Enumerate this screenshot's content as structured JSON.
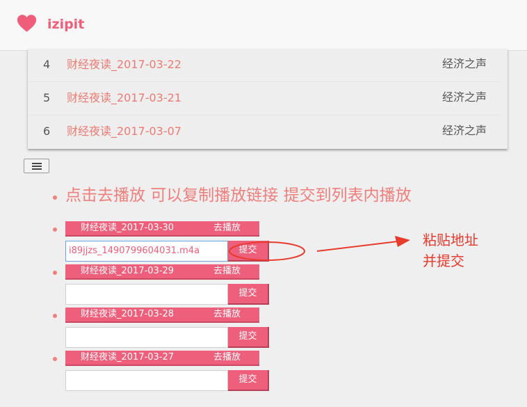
{
  "header": {
    "brand": "izipit",
    "logo_icon": "heart-icon",
    "brand_color": "#ef5d79"
  },
  "table": {
    "rows": [
      {
        "num": "4",
        "title": "财经夜读_2017-03-22",
        "source": "经济之声"
      },
      {
        "num": "5",
        "title": "财经夜读_2017-03-21",
        "source": "经济之声"
      },
      {
        "num": "6",
        "title": "财经夜读_2017-03-07",
        "source": "经济之声"
      }
    ]
  },
  "menu_button_icon": "hamburger-icon",
  "heading": "点击去播放 可以复制播放链接 提交到列表内播放",
  "items": [
    {
      "title": "财经夜读_2017-03-30",
      "play_label": "去播放",
      "input_value": "i89jjzs_1490799604031.m4a",
      "submit_label": "提交"
    },
    {
      "title": "财经夜读_2017-03-29",
      "play_label": "去播放",
      "input_value": "",
      "submit_label": "提交"
    },
    {
      "title": "财经夜读_2017-03-28",
      "play_label": "去播放",
      "input_value": "",
      "submit_label": "提交"
    },
    {
      "title": "财经夜读_2017-03-27",
      "play_label": "去播放",
      "input_value": "",
      "submit_label": "提交"
    }
  ],
  "annotation": {
    "line1": "粘贴地址",
    "line2": "并提交",
    "color": "#e83a2d"
  },
  "colors": {
    "accent": "#ee5f7c",
    "link": "#ec7a72",
    "background": "#efefef"
  }
}
